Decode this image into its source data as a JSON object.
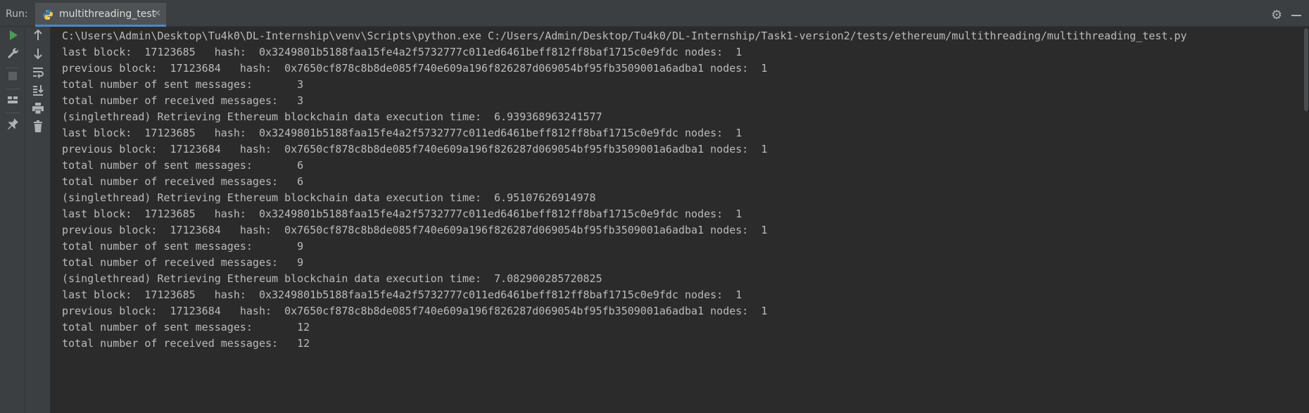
{
  "window": {
    "run_label": "Run:",
    "tab_title": "multithreading_test"
  },
  "icons": {
    "tab": "python-file-icon",
    "close": "close-icon",
    "settings": "gear-icon",
    "minimize": "minimize-icon",
    "left_toolbar": [
      "run-icon",
      "wrench-icon",
      "stop-icon",
      "layout-icon",
      "pin-icon"
    ],
    "console_toolbar": [
      "arrow-up-icon",
      "arrow-down-icon",
      "soft-wrap-icon",
      "scroll-to-end-icon",
      "print-icon",
      "trash-icon"
    ]
  },
  "colors": {
    "background": "#2b2b2b",
    "toolbar": "#3c3f41",
    "run_green": "#499c54",
    "tab_accent": "#4a88c7",
    "text": "#bbbbbb"
  },
  "console": {
    "lines": [
      "C:\\Users\\Admin\\Desktop\\Tu4k0\\DL-Internship\\venv\\Scripts\\python.exe C:/Users/Admin/Desktop/Tu4k0/DL-Internship/Task1-version2/tests/ethereum/multithreading/multithreading_test.py",
      "last block:  17123685   hash:  0x3249801b5188faa15fe4a2f5732777c011ed6461beff812ff8baf1715c0e9fdc nodes:  1",
      "previous block:  17123684   hash:  0x7650cf878c8b8de085f740e609a196f826287d069054bf95fb3509001a6adba1 nodes:  1",
      "total number of sent messages:       3",
      "total number of received messages:   3",
      "(singlethread) Retrieving Ethereum blockchain data execution time:  6.939368963241577",
      "last block:  17123685   hash:  0x3249801b5188faa15fe4a2f5732777c011ed6461beff812ff8baf1715c0e9fdc nodes:  1",
      "previous block:  17123684   hash:  0x7650cf878c8b8de085f740e609a196f826287d069054bf95fb3509001a6adba1 nodes:  1",
      "total number of sent messages:       6",
      "total number of received messages:   6",
      "(singlethread) Retrieving Ethereum blockchain data execution time:  6.95107626914978",
      "last block:  17123685   hash:  0x3249801b5188faa15fe4a2f5732777c011ed6461beff812ff8baf1715c0e9fdc nodes:  1",
      "previous block:  17123684   hash:  0x7650cf878c8b8de085f740e609a196f826287d069054bf95fb3509001a6adba1 nodes:  1",
      "total number of sent messages:       9",
      "total number of received messages:   9",
      "(singlethread) Retrieving Ethereum blockchain data execution time:  7.082900285720825",
      "last block:  17123685   hash:  0x3249801b5188faa15fe4a2f5732777c011ed6461beff812ff8baf1715c0e9fdc nodes:  1",
      "previous block:  17123684   hash:  0x7650cf878c8b8de085f740e609a196f826287d069054bf95fb3509001a6adba1 nodes:  1",
      "total number of sent messages:       12",
      "total number of received messages:   12"
    ]
  }
}
